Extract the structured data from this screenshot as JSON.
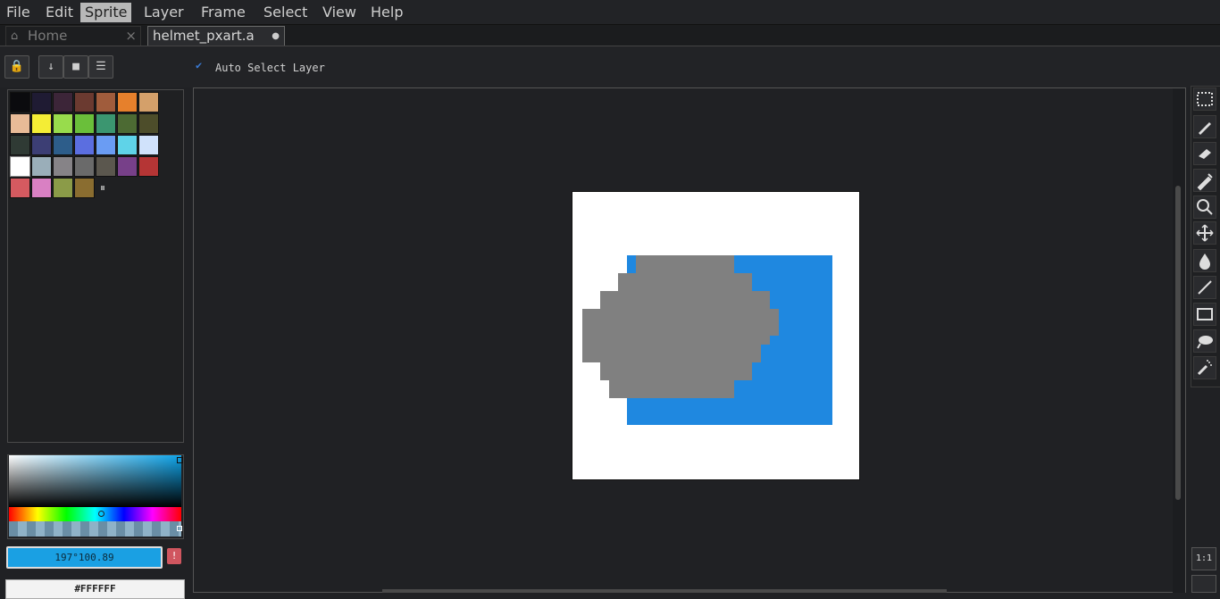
{
  "menu": [
    "File",
    "Edit",
    "Sprite",
    "Layer",
    "Frame",
    "Select",
    "View",
    "Help"
  ],
  "active_menu": "Sprite",
  "tabs": {
    "home": {
      "label": "Home",
      "close": "×"
    },
    "file": {
      "label": "helmet_pxart.a",
      "modified_dot": "●"
    }
  },
  "toolbar": {
    "lock_icon": "🔒",
    "down_icon": "↓",
    "page_icon": "■",
    "menu_icon": "☰",
    "auto_select_check": "✔",
    "auto_select_label": "Auto Select Layer"
  },
  "palette": {
    "swatches": [
      "#0b0b0e",
      "#1f1b33",
      "#3c2538",
      "#6b3a30",
      "#a05c3c",
      "#e6802c",
      "#d4a06a",
      "#e8bb97",
      "#f4ed35",
      "#98dc4c",
      "#6abf3a",
      "#3b9670",
      "#4c6a33",
      "#4d4d2a",
      "#2f3a34",
      "#3c3e74",
      "#2d5d8a",
      "#5b6ee0",
      "#6a9cf3",
      "#5fd3e8",
      "#d0e2fb",
      "#ffffff",
      "#9aaeb9",
      "#868387",
      "#6a6a6a",
      "#5b574e",
      "#774089",
      "#b53535",
      "#d55a60",
      "#d980c3",
      "#8b9b48",
      "#8a6d30"
    ],
    "more_icon": "⏸"
  },
  "color": {
    "value": "197°100.89",
    "hex": "#FFFFFF",
    "warn": "!",
    "accent": "#1aa0e3"
  },
  "sprite_colors": {
    "gray": "#808080",
    "blue": "#1f88e0",
    "bg": "#ffffff"
  },
  "tools": [
    "marquee-icon",
    "pencil-icon",
    "eraser-icon",
    "eyedropper-icon",
    "zoom-icon",
    "move-icon",
    "fill-icon",
    "line-icon",
    "rectangle-icon",
    "lasso-icon",
    "spray-icon"
  ],
  "zoom_reset": "1:1"
}
